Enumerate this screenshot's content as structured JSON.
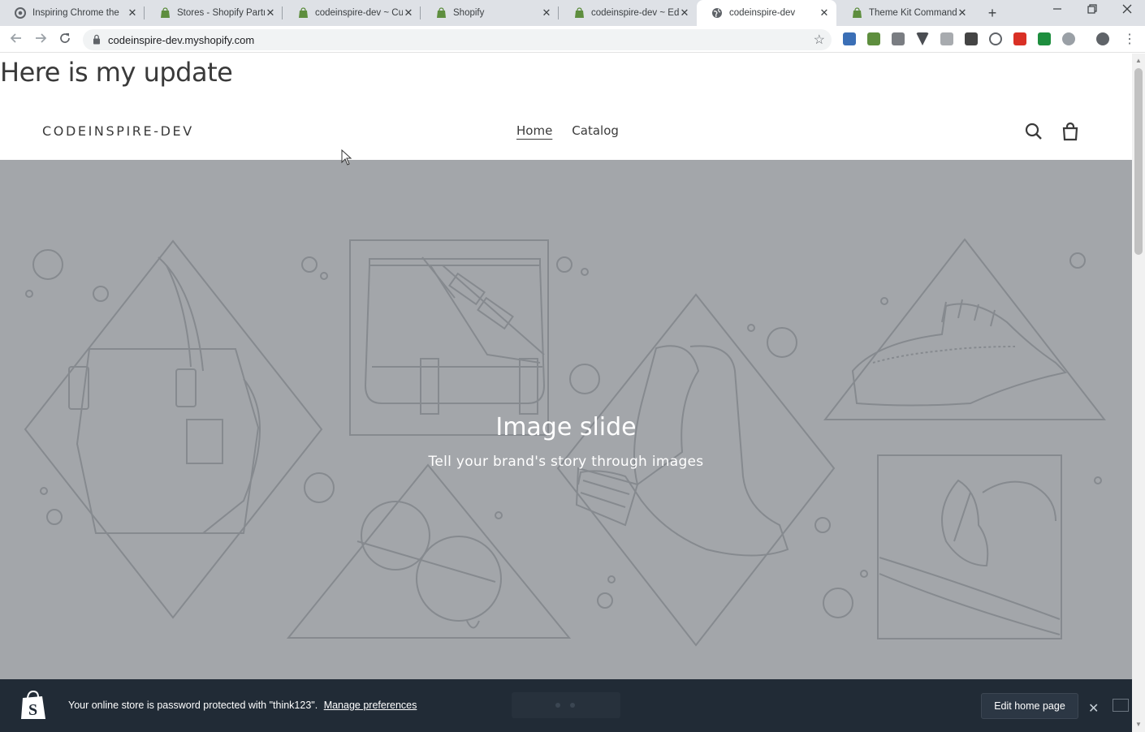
{
  "browser": {
    "tabs": [
      {
        "title": "Inspiring Chrome the",
        "icon": "chrome-icon",
        "active": false
      },
      {
        "title": "Stores - Shopify Partn",
        "icon": "shopify-icon",
        "active": false
      },
      {
        "title": "codeinspire-dev ~ Cu",
        "icon": "shopify-icon",
        "active": false
      },
      {
        "title": "Shopify",
        "icon": "shopify-icon",
        "active": false
      },
      {
        "title": "codeinspire-dev ~ Ed",
        "icon": "shopify-icon",
        "active": false
      },
      {
        "title": "codeinspire-dev",
        "icon": "globe-icon",
        "active": true
      },
      {
        "title": "Theme Kit Commands",
        "icon": "shopify-icon",
        "active": false
      }
    ],
    "close_glyph": "✕",
    "new_tab_glyph": "+",
    "url": "codeinspire-dev.myshopify.com"
  },
  "page": {
    "update_heading": "Here is my update",
    "store_logo": "CODEINSPIRE-DEV",
    "nav": {
      "home": "Home",
      "catalog": "Catalog"
    },
    "hero": {
      "title": "Image slide",
      "subtitle": "Tell your brand's story through images"
    }
  },
  "admin_bar": {
    "message": "Your online store is password protected with \"think123\".",
    "manage_link": "Manage preferences",
    "edit_button": "Edit home page",
    "close_glyph": "✕"
  },
  "colors": {
    "hero_bg": "#a3a6aa",
    "hero_line": "#868a8f",
    "admin_bg": "#212b36",
    "shopify_green": "#5e8e3e"
  }
}
